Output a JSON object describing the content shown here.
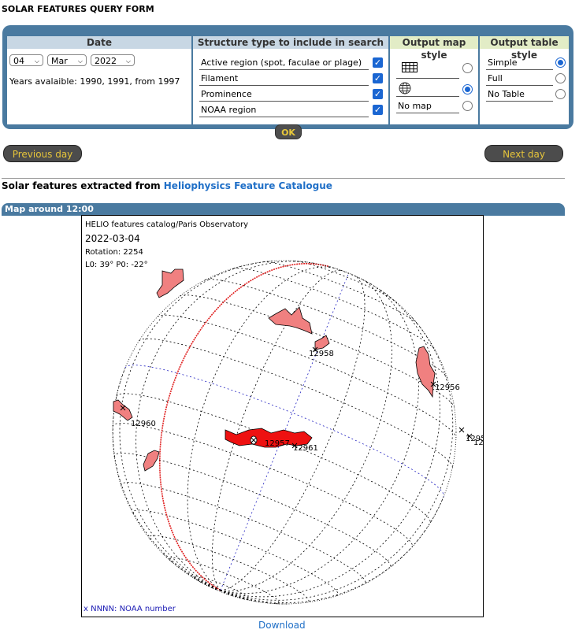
{
  "form": {
    "title": "SOLAR FEATURES QUERY FORM",
    "date_header": "Date",
    "day": "04",
    "month": "Mar",
    "year": "2022",
    "years_note": "Years avalaible: 1990, 1991, from 1997",
    "structure_header": "Structure type to include in search",
    "structures": [
      {
        "label": "Active region (spot, faculae or plage)",
        "checked": true
      },
      {
        "label": "Filament",
        "checked": true
      },
      {
        "label": "Prominence",
        "checked": true
      },
      {
        "label": "NOAA region",
        "checked": true
      }
    ],
    "map_style_header": "Output map style",
    "map_styles": [
      {
        "icon": "grid-icon",
        "label": "",
        "selected": false
      },
      {
        "icon": "globe-icon",
        "label": "",
        "selected": true
      },
      {
        "icon": "",
        "label": "No map",
        "selected": false
      }
    ],
    "table_style_header": "Output table style",
    "table_styles": [
      {
        "label": "Simple",
        "selected": true
      },
      {
        "label": "Full",
        "selected": false
      },
      {
        "label": "No Table",
        "selected": false
      }
    ],
    "ok_label": "OK"
  },
  "nav": {
    "previous_label": "Previous day",
    "next_label": "Next day"
  },
  "results": {
    "prefix": "Solar features extracted from ",
    "link_text": "Heliophysics Feature Catalogue"
  },
  "map": {
    "bar_title": "Map around 12:00",
    "catalog": "HELIO features catalog/Paris Observatory",
    "date": "2022-03-04",
    "rotation": "Rotation: 2254",
    "angles": "L0: 39° P0: -22°",
    "legend": "x NNNN: NOAA number",
    "noaa_labels": [
      "12958",
      "12956",
      "12960",
      "12957",
      "12961",
      "1295",
      "12"
    ],
    "download_label": "Download",
    "colors": {
      "active_region": "#ee1111",
      "filament": "#f08080",
      "meridian": "#e02020",
      "grid": "#000000",
      "equator_grid": "#2020c0"
    }
  }
}
